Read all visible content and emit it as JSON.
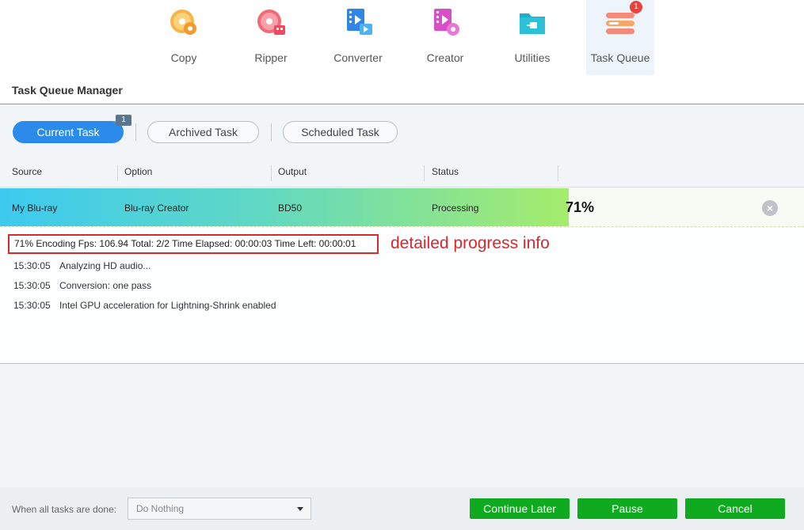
{
  "nav": {
    "items": [
      {
        "label": "Copy",
        "icon": "copy-disc-icon"
      },
      {
        "label": "Ripper",
        "icon": "ripper-disc-icon"
      },
      {
        "label": "Converter",
        "icon": "converter-film-icon"
      },
      {
        "label": "Creator",
        "icon": "creator-film-icon"
      },
      {
        "label": "Utilities",
        "icon": "utilities-folder-icon"
      },
      {
        "label": "Task Queue",
        "icon": "task-queue-icon"
      }
    ],
    "badge": "1",
    "active": "Task Queue"
  },
  "page_title": "Task Queue Manager",
  "tabs": {
    "current": "Current Task",
    "current_badge": "1",
    "archived": "Archived Task",
    "scheduled": "Scheduled Task"
  },
  "columns": {
    "source": "Source",
    "option": "Option",
    "output": "Output",
    "status": "Status"
  },
  "task": {
    "source": "My Blu-ray",
    "option": "Blu-ray Creator",
    "output": "BD50",
    "status": "Processing",
    "percent_text": "71%",
    "progress": 0.71
  },
  "detail": "71%  Encoding Fps: 106.94  Total: 2/2  Time Elapsed: 00:00:03  Time Left: 00:00:01",
  "annotation": "detailed progress info",
  "log": [
    {
      "time": "15:30:05",
      "msg": "Analyzing HD audio..."
    },
    {
      "time": "15:30:05",
      "msg": "Conversion: one pass"
    },
    {
      "time": "15:30:05",
      "msg": "Intel GPU acceleration for Lightning-Shrink enabled"
    }
  ],
  "footer": {
    "when_done_label": "When all tasks are done:",
    "when_done_value": "Do Nothing",
    "continue_later": "Continue Later",
    "pause": "Pause",
    "cancel": "Cancel"
  },
  "colors": {
    "accent": "#2a8bea",
    "green": "#0faa1f",
    "annotation_red": "#d8282a",
    "badge_red": "#e8423a"
  }
}
